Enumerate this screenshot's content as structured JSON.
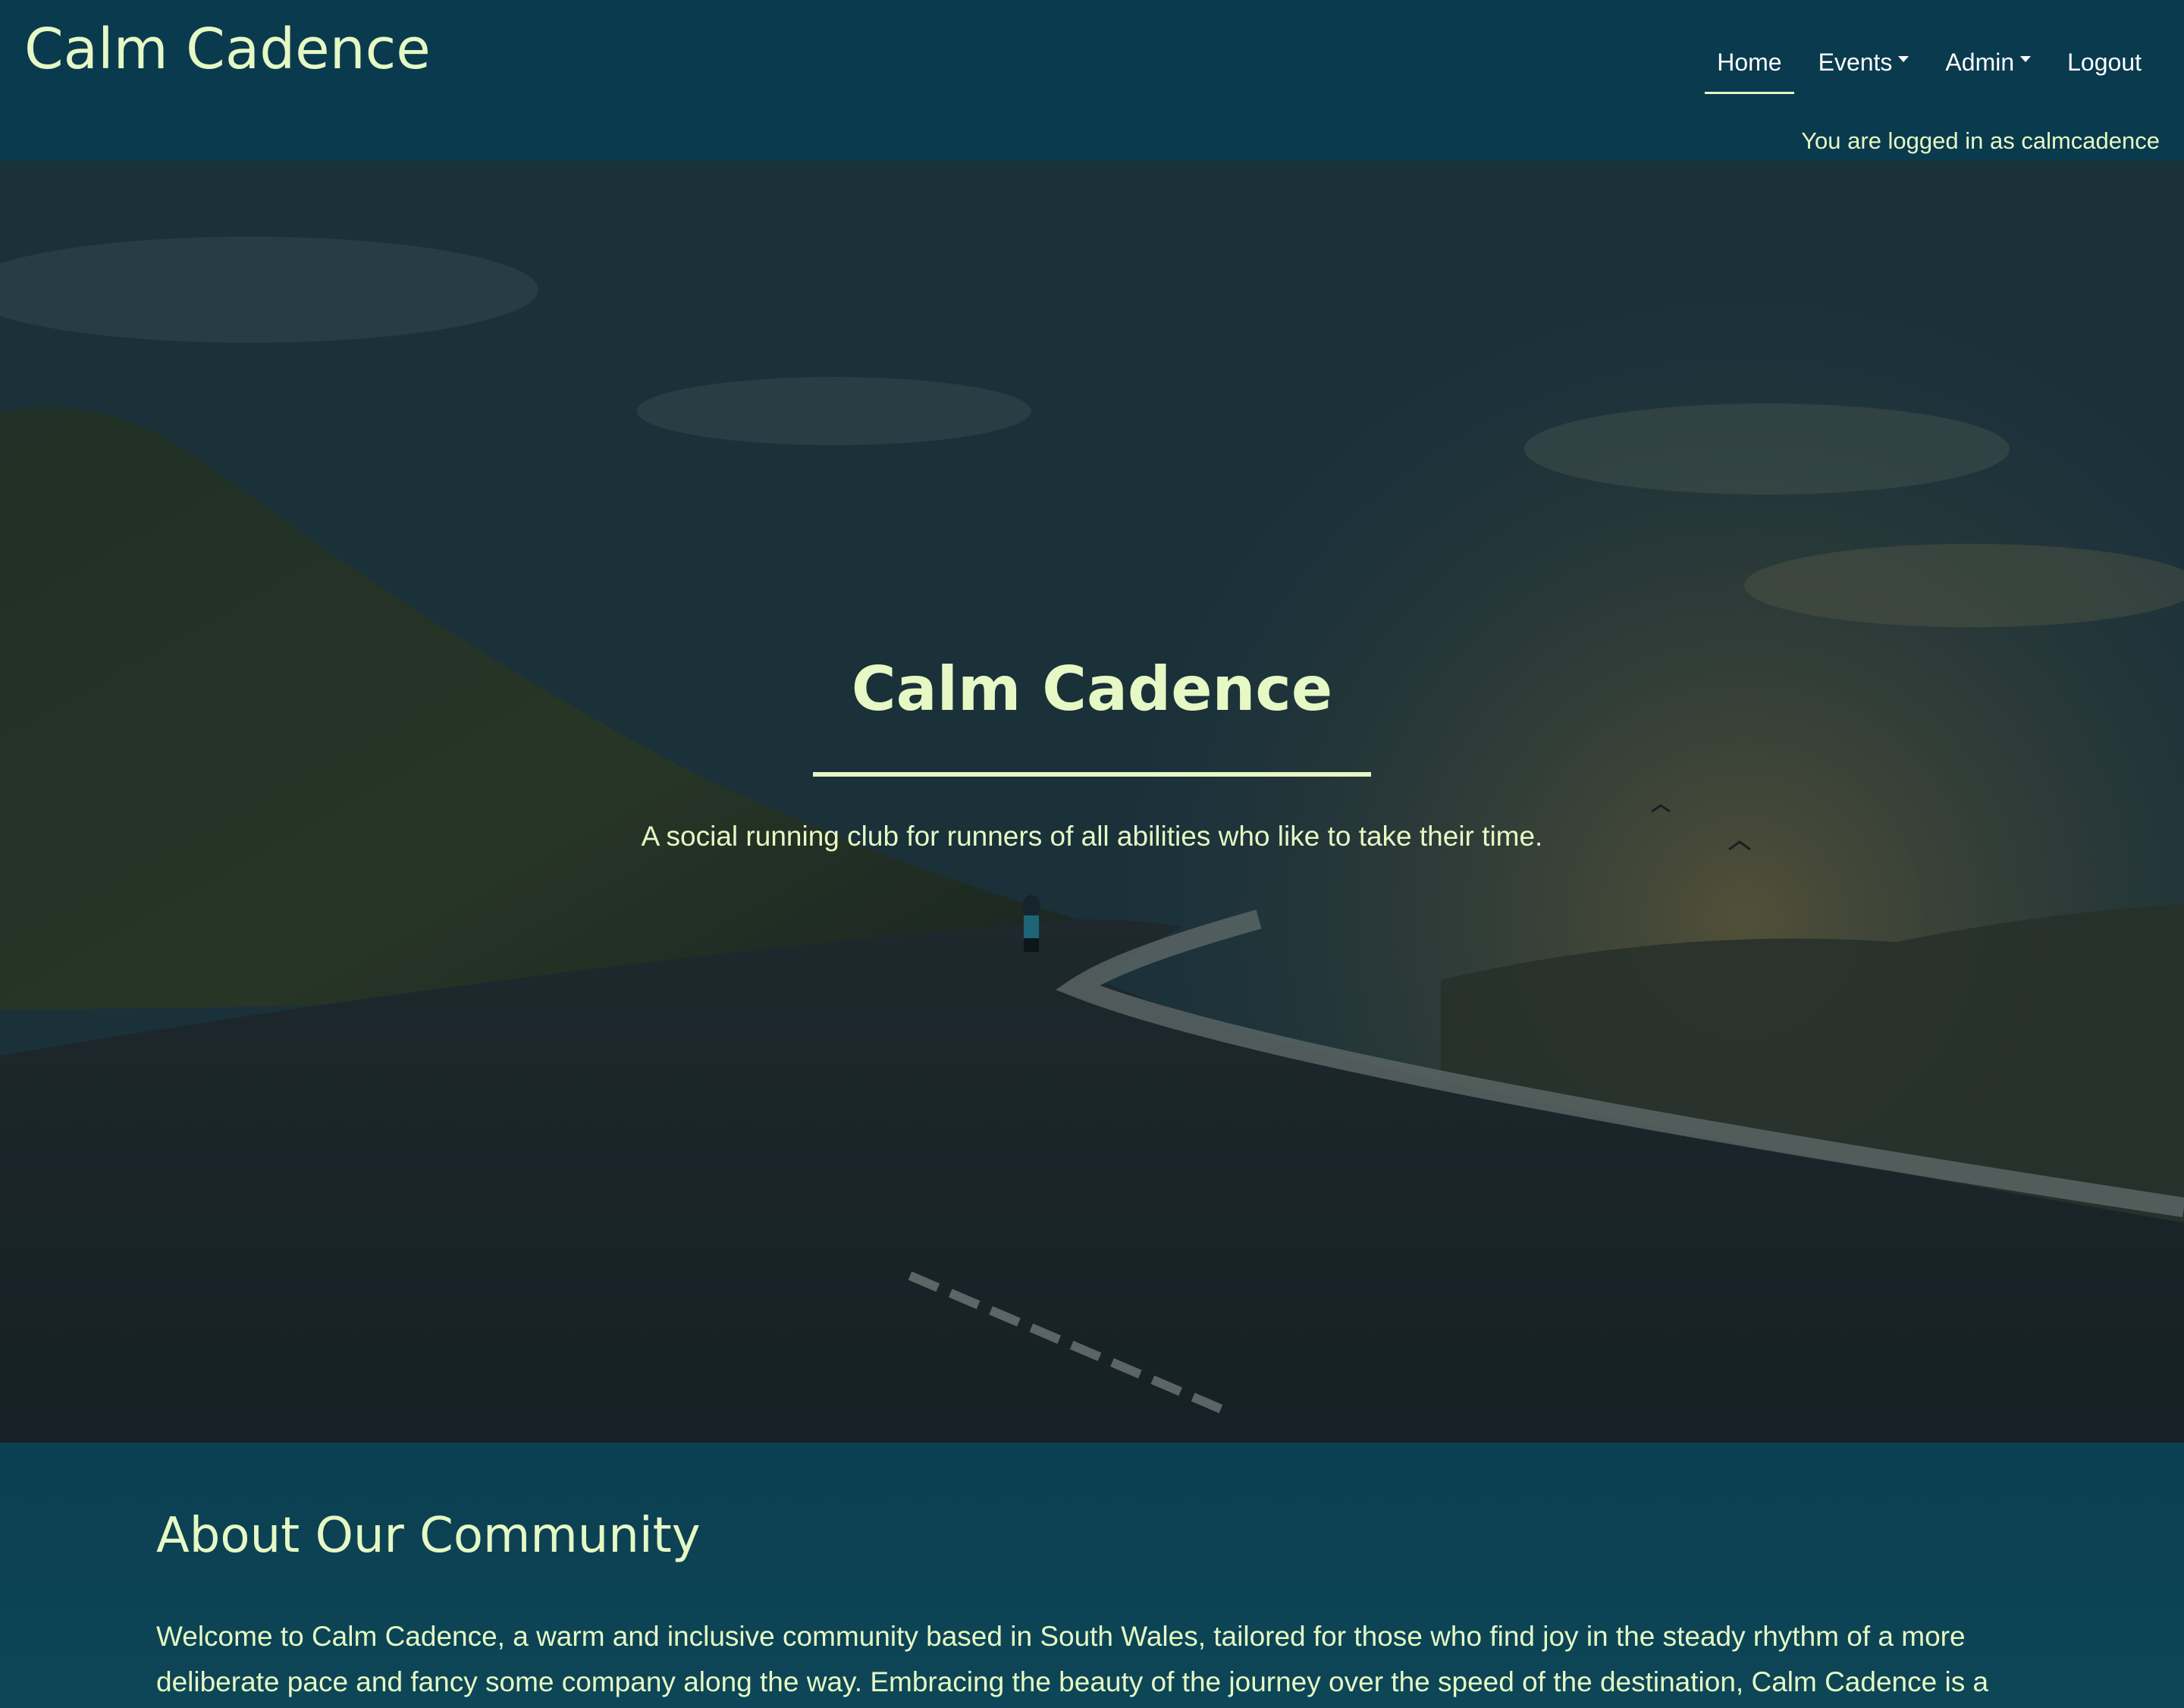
{
  "header": {
    "brand": "Calm Cadence",
    "nav": {
      "home": "Home",
      "events": "Events",
      "admin": "Admin",
      "logout": "Logout"
    },
    "login_status": "You are logged in as calmcadence"
  },
  "hero": {
    "title": "Calm Cadence",
    "tagline": "A social running club for runners of all abilities who like to take their time."
  },
  "about": {
    "heading": "About Our Community",
    "body": "Welcome to Calm Cadence, a warm and inclusive community based in South Wales, tailored for those who find joy in the steady rhythm of a more deliberate pace and fancy some company along the way. Embracing the beauty of the journey over the speed of the destination, Calm Cadence is a"
  },
  "colors": {
    "header_bg": "#0a3a4e",
    "accent_text": "#e6f8c4",
    "section_bg": "#0b3f52"
  },
  "icons": {
    "dropdown": "caret-down-icon"
  }
}
